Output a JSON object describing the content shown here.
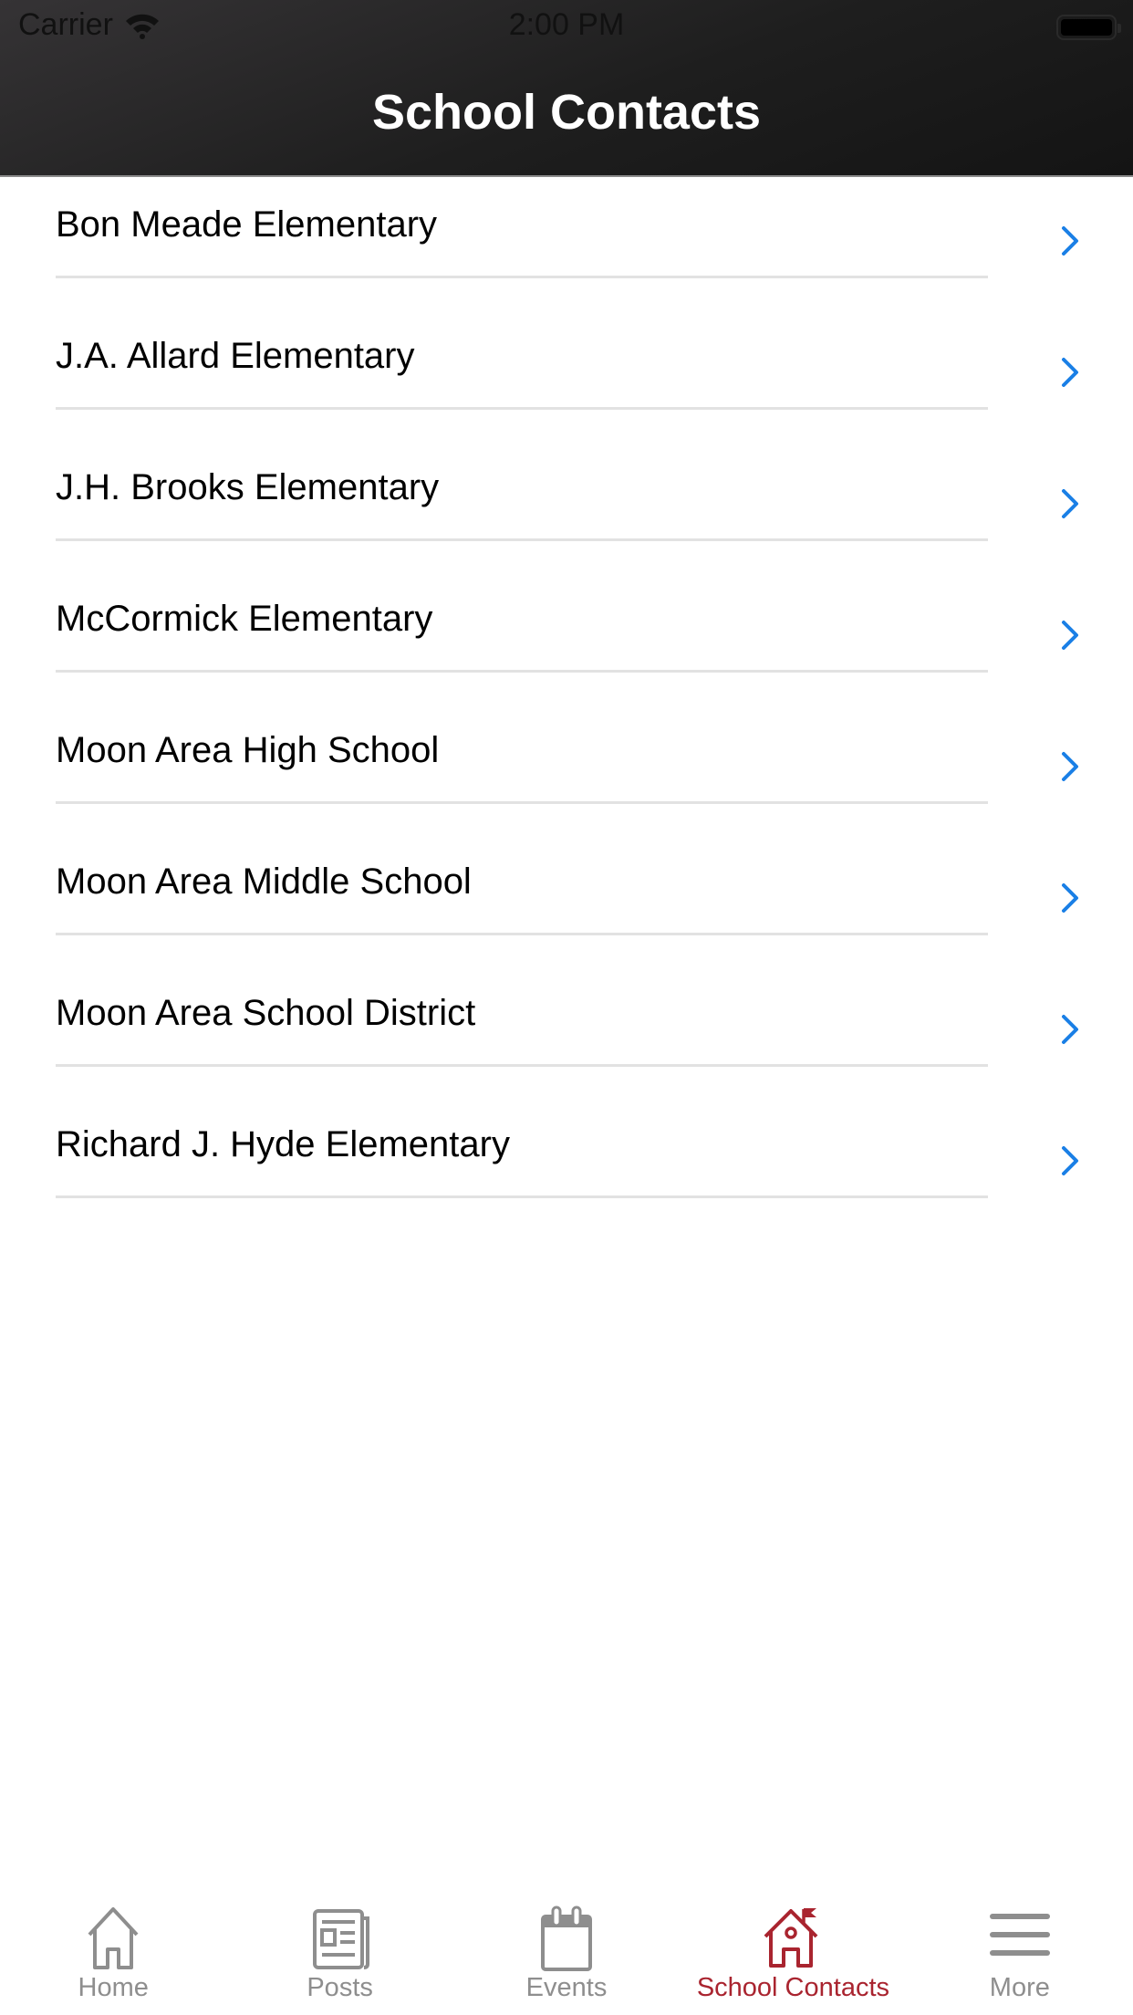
{
  "status_bar": {
    "carrier": "Carrier",
    "time": "2:00 PM",
    "battery": "full"
  },
  "header": {
    "title": "School Contacts"
  },
  "contacts": [
    {
      "label": "Bon Meade Elementary"
    },
    {
      "label": "J.A. Allard Elementary"
    },
    {
      "label": "J.H. Brooks Elementary"
    },
    {
      "label": "McCormick Elementary"
    },
    {
      "label": "Moon Area High School"
    },
    {
      "label": "Moon Area Middle School"
    },
    {
      "label": "Moon Area School District"
    },
    {
      "label": "Richard J. Hyde Elementary"
    }
  ],
  "tabbar": {
    "tabs": [
      {
        "label": "Home",
        "icon": "home-icon"
      },
      {
        "label": "Posts",
        "icon": "newspaper-icon"
      },
      {
        "label": "Events",
        "icon": "calendar-icon"
      },
      {
        "label": "School Contacts",
        "icon": "schoolhouse-icon",
        "active": true
      },
      {
        "label": "More",
        "icon": "menu-icon"
      }
    ]
  },
  "colors": {
    "accent": "#a9242f",
    "chevron": "#1a7fe6",
    "inactive": "#8e8e8e"
  }
}
